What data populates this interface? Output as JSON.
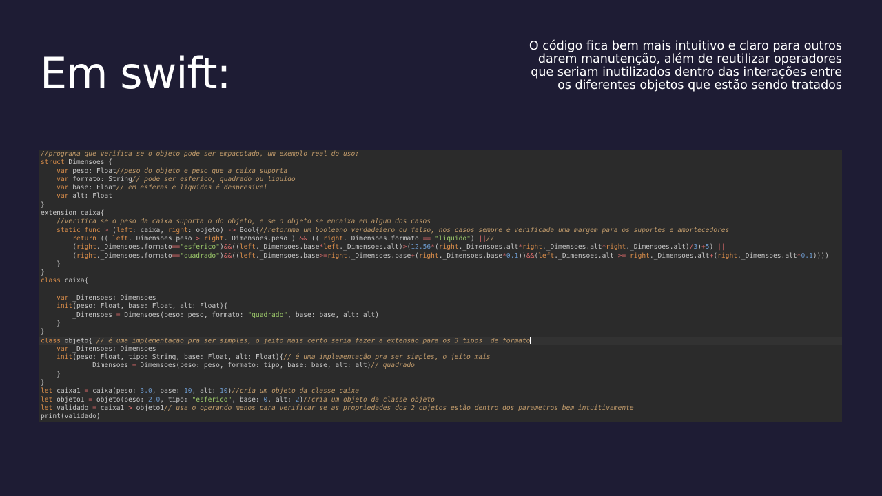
{
  "slide": {
    "title": "Em swift:",
    "description": "O código fica bem mais intuitivo e claro para outros darem manutenção, além de reutilizar operadores que seriam inutilizados dentro das interações entre os diferentes objetos que estão sendo tratados"
  },
  "code": {
    "lines": [
      {
        "parts": [
          {
            "t": "c",
            "v": "//programa que verifica se o objeto pode ser empacotado, um exemplo real do uso:"
          }
        ]
      },
      {
        "parts": [
          {
            "t": "k",
            "v": "struct"
          },
          {
            "t": "p",
            "v": " Dimensoes {"
          }
        ]
      },
      {
        "parts": [
          {
            "t": "p",
            "v": "    "
          },
          {
            "t": "k",
            "v": "var"
          },
          {
            "t": "p",
            "v": " peso: Float"
          },
          {
            "t": "c",
            "v": "//peso do objeto e peso que a caixa suporta"
          }
        ]
      },
      {
        "parts": [
          {
            "t": "p",
            "v": "    "
          },
          {
            "t": "k",
            "v": "var"
          },
          {
            "t": "p",
            "v": " formato: String"
          },
          {
            "t": "c",
            "v": "// pode ser esferico, quadrado ou liquido"
          }
        ]
      },
      {
        "parts": [
          {
            "t": "p",
            "v": "    "
          },
          {
            "t": "k",
            "v": "var"
          },
          {
            "t": "p",
            "v": " base: Float"
          },
          {
            "t": "c",
            "v": "// em esferas e liquidos é despresivel"
          }
        ]
      },
      {
        "parts": [
          {
            "t": "p",
            "v": "    "
          },
          {
            "t": "k",
            "v": "var"
          },
          {
            "t": "p",
            "v": " alt: Float"
          }
        ]
      },
      {
        "parts": [
          {
            "t": "p",
            "v": "}"
          }
        ]
      },
      {
        "parts": [
          {
            "t": "p",
            "v": "extension caixa{"
          }
        ]
      },
      {
        "parts": [
          {
            "t": "p",
            "v": "    "
          },
          {
            "t": "c",
            "v": "//verifica se o peso da caixa suporta o do objeto, e se o objeto se encaixa em algum dos casos"
          }
        ]
      },
      {
        "parts": [
          {
            "t": "p",
            "v": "    "
          },
          {
            "t": "k",
            "v": "static func"
          },
          {
            "t": "p",
            "v": " "
          },
          {
            "t": "o",
            "v": ">"
          },
          {
            "t": "p",
            "v": " ("
          },
          {
            "t": "k",
            "v": "left"
          },
          {
            "t": "p",
            "v": ": caixa, "
          },
          {
            "t": "k",
            "v": "right"
          },
          {
            "t": "p",
            "v": ": objeto) "
          },
          {
            "t": "o",
            "v": "->"
          },
          {
            "t": "p",
            "v": " Bool{"
          },
          {
            "t": "c",
            "v": "//retornma um booleano verdadeiero ou falso, nos casos sempre é verificada uma margem para os suportes e amortecedores"
          }
        ]
      },
      {
        "parts": [
          {
            "t": "p",
            "v": "        "
          },
          {
            "t": "k",
            "v": "return"
          },
          {
            "t": "p",
            "v": " (( "
          },
          {
            "t": "k",
            "v": "left"
          },
          {
            "t": "p",
            "v": "._Dimensoes.peso "
          },
          {
            "t": "o",
            "v": ">"
          },
          {
            "t": "p",
            "v": " "
          },
          {
            "t": "k",
            "v": "right"
          },
          {
            "t": "p",
            "v": "._Dimensoes.peso ) "
          },
          {
            "t": "o",
            "v": "&&"
          },
          {
            "t": "p",
            "v": " (( "
          },
          {
            "t": "k",
            "v": "right"
          },
          {
            "t": "p",
            "v": "._Dimensoes.formato "
          },
          {
            "t": "o",
            "v": "=="
          },
          {
            "t": "p",
            "v": " "
          },
          {
            "t": "s",
            "v": "\"liquido\""
          },
          {
            "t": "p",
            "v": ") "
          },
          {
            "t": "o",
            "v": "||"
          },
          {
            "t": "c",
            "v": "//"
          }
        ]
      },
      {
        "parts": [
          {
            "t": "p",
            "v": "        ("
          },
          {
            "t": "k",
            "v": "right"
          },
          {
            "t": "p",
            "v": "._Dimensoes.formato"
          },
          {
            "t": "o",
            "v": "=="
          },
          {
            "t": "s",
            "v": "\"esferico\""
          },
          {
            "t": "p",
            "v": ")"
          },
          {
            "t": "o",
            "v": "&&"
          },
          {
            "t": "p",
            "v": "(("
          },
          {
            "t": "k",
            "v": "left"
          },
          {
            "t": "p",
            "v": "._Dimensoes.base"
          },
          {
            "t": "o",
            "v": "*"
          },
          {
            "t": "k",
            "v": "left"
          },
          {
            "t": "p",
            "v": "._Dimensoes.alt)"
          },
          {
            "t": "o",
            "v": ">"
          },
          {
            "t": "p",
            "v": "("
          },
          {
            "t": "n",
            "v": "12.56"
          },
          {
            "t": "o",
            "v": "*"
          },
          {
            "t": "p",
            "v": "("
          },
          {
            "t": "k",
            "v": "right"
          },
          {
            "t": "p",
            "v": "._Dimensoes.alt"
          },
          {
            "t": "o",
            "v": "*"
          },
          {
            "t": "k",
            "v": "right"
          },
          {
            "t": "p",
            "v": "._Dimensoes.alt"
          },
          {
            "t": "o",
            "v": "*"
          },
          {
            "t": "k",
            "v": "right"
          },
          {
            "t": "p",
            "v": "._Dimensoes.alt)"
          },
          {
            "t": "o",
            "v": "/"
          },
          {
            "t": "n",
            "v": "3"
          },
          {
            "t": "p",
            "v": ")"
          },
          {
            "t": "o",
            "v": "+"
          },
          {
            "t": "n",
            "v": "5"
          },
          {
            "t": "p",
            "v": ") "
          },
          {
            "t": "o",
            "v": "||"
          }
        ]
      },
      {
        "parts": [
          {
            "t": "p",
            "v": "        ("
          },
          {
            "t": "k",
            "v": "right"
          },
          {
            "t": "p",
            "v": "._Dimensoes.formato"
          },
          {
            "t": "o",
            "v": "=="
          },
          {
            "t": "s",
            "v": "\"quadrado\""
          },
          {
            "t": "p",
            "v": ")"
          },
          {
            "t": "o",
            "v": "&&"
          },
          {
            "t": "p",
            "v": "(("
          },
          {
            "t": "k",
            "v": "left"
          },
          {
            "t": "p",
            "v": "._Dimensoes.base"
          },
          {
            "t": "o",
            "v": ">="
          },
          {
            "t": "k",
            "v": "right"
          },
          {
            "t": "p",
            "v": "._Dimensoes.base"
          },
          {
            "t": "o",
            "v": "+"
          },
          {
            "t": "p",
            "v": "("
          },
          {
            "t": "k",
            "v": "right"
          },
          {
            "t": "p",
            "v": "._Dimensoes.base"
          },
          {
            "t": "o",
            "v": "*"
          },
          {
            "t": "n",
            "v": "0.1"
          },
          {
            "t": "p",
            "v": "))"
          },
          {
            "t": "o",
            "v": "&&"
          },
          {
            "t": "p",
            "v": "("
          },
          {
            "t": "k",
            "v": "left"
          },
          {
            "t": "p",
            "v": "._Dimensoes.alt "
          },
          {
            "t": "o",
            "v": ">="
          },
          {
            "t": "p",
            "v": " "
          },
          {
            "t": "k",
            "v": "right"
          },
          {
            "t": "p",
            "v": "._Dimensoes.alt"
          },
          {
            "t": "o",
            "v": "+"
          },
          {
            "t": "p",
            "v": "("
          },
          {
            "t": "k",
            "v": "right"
          },
          {
            "t": "p",
            "v": "._Dimensoes.alt"
          },
          {
            "t": "o",
            "v": "*"
          },
          {
            "t": "n",
            "v": "0.1"
          },
          {
            "t": "p",
            "v": "))))"
          }
        ]
      },
      {
        "parts": [
          {
            "t": "p",
            "v": "    }"
          }
        ]
      },
      {
        "parts": [
          {
            "t": "p",
            "v": "}"
          }
        ]
      },
      {
        "parts": [
          {
            "t": "k",
            "v": "class"
          },
          {
            "t": "p",
            "v": " caixa{"
          }
        ]
      },
      {
        "parts": [
          {
            "t": "p",
            "v": ""
          }
        ]
      },
      {
        "parts": [
          {
            "t": "p",
            "v": "    "
          },
          {
            "t": "k",
            "v": "var"
          },
          {
            "t": "p",
            "v": " _Dimensoes: Dimensoes"
          }
        ]
      },
      {
        "parts": [
          {
            "t": "p",
            "v": "    "
          },
          {
            "t": "k",
            "v": "init"
          },
          {
            "t": "p",
            "v": "(peso: Float, base: Float, alt: Float){"
          }
        ]
      },
      {
        "parts": [
          {
            "t": "p",
            "v": "        _Dimensoes "
          },
          {
            "t": "o",
            "v": "="
          },
          {
            "t": "p",
            "v": " Dimensoes(peso: peso, formato: "
          },
          {
            "t": "s",
            "v": "\"quadrado\""
          },
          {
            "t": "p",
            "v": ", base: base, alt: alt)"
          }
        ]
      },
      {
        "parts": [
          {
            "t": "p",
            "v": "    }"
          }
        ]
      },
      {
        "parts": [
          {
            "t": "p",
            "v": "}"
          }
        ]
      },
      {
        "hl": true,
        "caret": true,
        "parts": [
          {
            "t": "k",
            "v": "class"
          },
          {
            "t": "p",
            "v": " objeto{ "
          },
          {
            "t": "c",
            "v": "// é uma implementação pra ser simples, o jeito mais certo seria fazer a extensão para os 3 tipos  de formato"
          }
        ]
      },
      {
        "parts": [
          {
            "t": "p",
            "v": "    "
          },
          {
            "t": "k",
            "v": "var"
          },
          {
            "t": "p",
            "v": " _Dimensoes: Dimensoes"
          }
        ]
      },
      {
        "parts": [
          {
            "t": "p",
            "v": "    "
          },
          {
            "t": "k",
            "v": "init"
          },
          {
            "t": "p",
            "v": "(peso: Float, tipo: String, base: Float, alt: Float){"
          },
          {
            "t": "c",
            "v": "// é uma implementação pra ser simples, o jeito mais"
          }
        ]
      },
      {
        "parts": [
          {
            "t": "p",
            "v": "            _Dimensoes "
          },
          {
            "t": "o",
            "v": "="
          },
          {
            "t": "p",
            "v": " Dimensoes(peso: peso, formato: tipo, base: base, alt: alt)"
          },
          {
            "t": "c",
            "v": "// quadrado"
          }
        ]
      },
      {
        "parts": [
          {
            "t": "p",
            "v": "    }"
          }
        ]
      },
      {
        "parts": [
          {
            "t": "p",
            "v": "}"
          }
        ]
      },
      {
        "parts": [
          {
            "t": "k",
            "v": "let"
          },
          {
            "t": "p",
            "v": " caixa1 "
          },
          {
            "t": "o",
            "v": "="
          },
          {
            "t": "p",
            "v": " caixa(peso: "
          },
          {
            "t": "n",
            "v": "3.0"
          },
          {
            "t": "p",
            "v": ", base: "
          },
          {
            "t": "n",
            "v": "10"
          },
          {
            "t": "p",
            "v": ", alt: "
          },
          {
            "t": "n",
            "v": "10"
          },
          {
            "t": "p",
            "v": ")"
          },
          {
            "t": "c",
            "v": "//cria um objeto da classe caixa"
          }
        ]
      },
      {
        "parts": [
          {
            "t": "k",
            "v": "let"
          },
          {
            "t": "p",
            "v": " objeto1 "
          },
          {
            "t": "o",
            "v": "="
          },
          {
            "t": "p",
            "v": " objeto(peso: "
          },
          {
            "t": "n",
            "v": "2.0"
          },
          {
            "t": "p",
            "v": ", tipo: "
          },
          {
            "t": "s",
            "v": "\"esferico\""
          },
          {
            "t": "p",
            "v": ", base: "
          },
          {
            "t": "n",
            "v": "0"
          },
          {
            "t": "p",
            "v": ", alt: "
          },
          {
            "t": "n",
            "v": "2"
          },
          {
            "t": "p",
            "v": ")"
          },
          {
            "t": "c",
            "v": "//cria um objeto da classe objeto"
          }
        ]
      },
      {
        "parts": [
          {
            "t": "k",
            "v": "let"
          },
          {
            "t": "p",
            "v": " validado "
          },
          {
            "t": "o",
            "v": "="
          },
          {
            "t": "p",
            "v": " caixa1 "
          },
          {
            "t": "o",
            "v": ">"
          },
          {
            "t": "p",
            "v": " objeto1"
          },
          {
            "t": "c",
            "v": "// usa o operando menos para verificar se as propriedades dos 2 objetos estão dentro dos parametros bem intuitivamente"
          }
        ]
      },
      {
        "parts": [
          {
            "t": "p",
            "v": "print(validado)"
          }
        ]
      }
    ]
  }
}
